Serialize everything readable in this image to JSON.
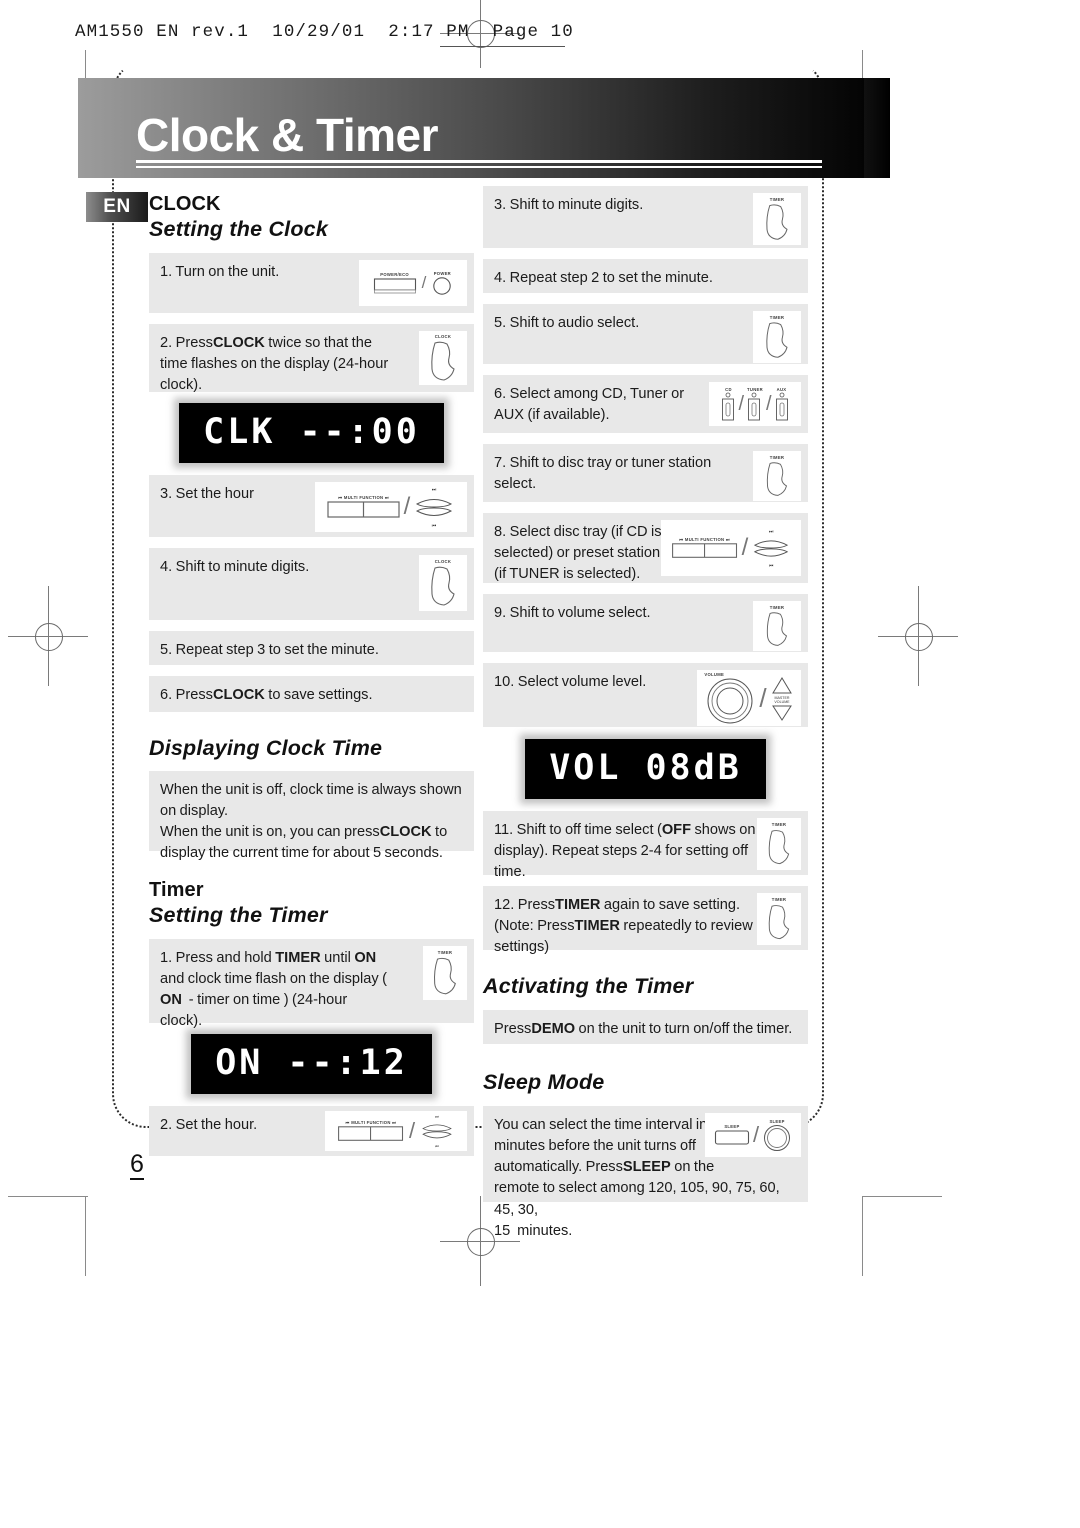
{
  "film_header": "AM1550 EN rev.1  10/29/01  2:17 PM  Page 10",
  "banner": {
    "title": "Clock & Timer"
  },
  "language_badge": "EN",
  "page_number": "6",
  "left_column": {
    "clock_heading": "CLOCK",
    "setting_clock_sub": "Setting the Clock",
    "steps_a": [
      {
        "text": "1. Turn on the unit.",
        "icon": "power-eco-and-power-button-icon"
      },
      {
        "text": "2. Press CLOCK twice so that the time flashes on the display (24-hour clock).",
        "icon": "clock-button-icon"
      }
    ],
    "lcd_1": "CLK --:00",
    "steps_b": [
      {
        "text": "3. Set the hour",
        "icon": "multi-function-and-skip-buttons-icon"
      },
      {
        "text": "4. Shift to minute digits.",
        "icon": "clock-button-icon"
      },
      {
        "text": "5. Repeat step 3 to set the minute.",
        "icon": ""
      },
      {
        "text": "6. Press CLOCK to save settings.",
        "icon": ""
      }
    ],
    "displaying_clock_sub": "Displaying Clock Time",
    "displaying_clock_body_line1": "When the unit is off, clock time is always shown on display.",
    "displaying_clock_body_line2": "When the unit is on, you can press CLOCK to display the current time for about 5 seconds.",
    "timer_heading": "Timer",
    "setting_timer_sub": "Setting the Timer",
    "timer_step_1": "1. Press and hold TIMER until ON and clock time flash on the display ( ON  - timer on time ) (24-hour clock).",
    "lcd_2": "ON --:12",
    "timer_step_2": "2. Set the hour."
  },
  "right_column": {
    "steps": [
      {
        "text": "3. Shift to minute digits.",
        "icon": "timer-button-icon"
      },
      {
        "text": "4. Repeat step 2 to set the minute.",
        "icon": ""
      },
      {
        "text": "5. Shift to audio select.",
        "icon": "timer-button-icon"
      },
      {
        "text": "6. Select among CD, Tuner or AUX (if available).",
        "icon": "cd-tuner-aux-buttons-icon"
      },
      {
        "text": "7. Shift to disc tray or tuner station select.",
        "icon": "timer-button-icon"
      },
      {
        "text": "8. Select disc tray (if CD is selected) or preset station (if TUNER is selected).",
        "icon": "multi-function-and-skip-buttons-icon"
      },
      {
        "text": "9. Shift to volume select.",
        "icon": "timer-button-icon"
      },
      {
        "text": "10. Select volume level.",
        "icon": "volume-knob-and-master-volume-icon"
      }
    ],
    "lcd_3": "VOL 08dB",
    "step_11": "11. Shift to off time select (OFF shows on display). Repeat steps 2-4 for setting off time.",
    "step_12": "12. Press TIMER again to save setting. (Note: Press TIMER repeatedly to review settings)",
    "activating_timer_sub": "Activating the Timer",
    "activating_timer_body": "Press DEMO on the unit to turn on/off the timer.",
    "sleep_mode_sub": "Sleep Mode",
    "sleep_mode_body": "You can select the time interval in minutes before the unit turns off automatically. Press SLEEP on the remote to select among 120, 105, 90, 75, 60,  45, 30, 15  minutes."
  },
  "icon_labels": {
    "power_eco": "POWER/ECO",
    "power": "POWER",
    "clock": "CLOCK",
    "timer": "TIMER",
    "multi_function": "MULTI FUNCTION",
    "master_volume": "MASTER VOLUME",
    "volume": "VOLUME",
    "cd": "CD",
    "tuner": "TUNER",
    "aux": "AUX",
    "sleep": "SLEEP"
  },
  "colors": {
    "step_background": "#e8e8e8",
    "banner_start": "#9c9c9c",
    "banner_end": "#000000",
    "lcd_background": "#000000",
    "lcd_text": "#ffffff"
  }
}
